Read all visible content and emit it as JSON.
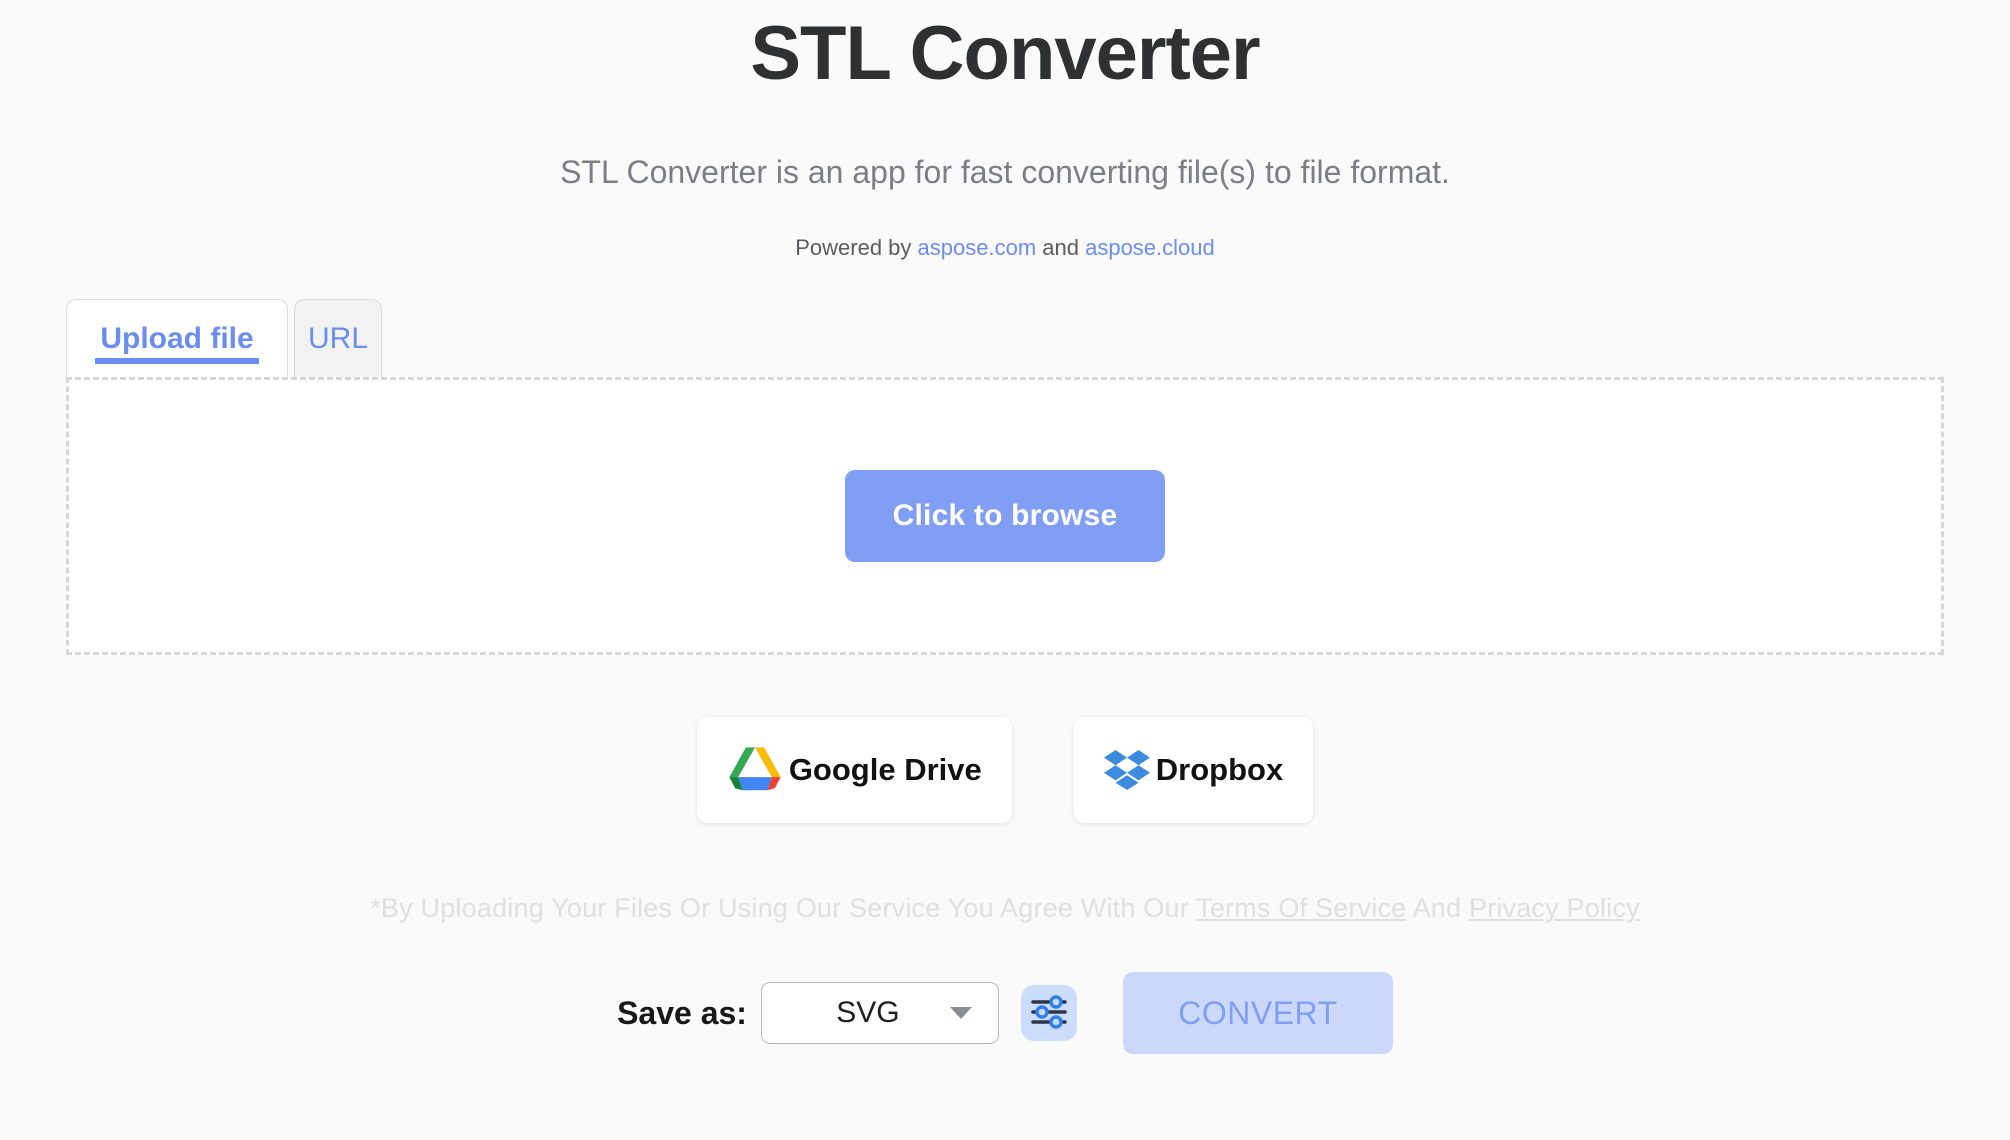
{
  "header": {
    "title": "STL Converter",
    "subtitle": "STL Converter is an app for fast converting file(s) to file format.",
    "powered_prefix": "Powered by ",
    "powered_link1": "aspose.com",
    "powered_mid": " and ",
    "powered_link2": "aspose.cloud"
  },
  "tabs": [
    {
      "id": "upload",
      "label": "Upload file",
      "active": true
    },
    {
      "id": "url",
      "label": "URL",
      "active": false
    }
  ],
  "dropzone": {
    "browse_label": "Click to browse"
  },
  "cloud_buttons": [
    {
      "id": "google-drive",
      "label": "Google Drive",
      "icon": "google-drive-icon"
    },
    {
      "id": "dropbox",
      "label": "Dropbox",
      "icon": "dropbox-icon"
    }
  ],
  "terms": {
    "prefix": "*By Uploading Your Files Or Using Our Service You Agree With Our ",
    "link1": "Terms Of Service",
    "mid": " And ",
    "link2": "Privacy Policy"
  },
  "bottom_bar": {
    "save_as_label": "Save as:",
    "format_value": "SVG",
    "format_options": [
      "SVG"
    ],
    "settings_icon": "sliders-icon",
    "convert_label": "CONVERT",
    "convert_disabled": true
  },
  "colors": {
    "background": "#fafafa",
    "accent_blue": "#7f9ef4",
    "link_blue": "#6b8df2",
    "title_dark": "#2e3032",
    "subtitle_gray": "#7b7f85",
    "terms_gray": "#dfe0e1",
    "convert_bg": "#ccd8fa",
    "settings_bg": "#ccdcfb",
    "dropzone_border": "#d6d6d6"
  }
}
